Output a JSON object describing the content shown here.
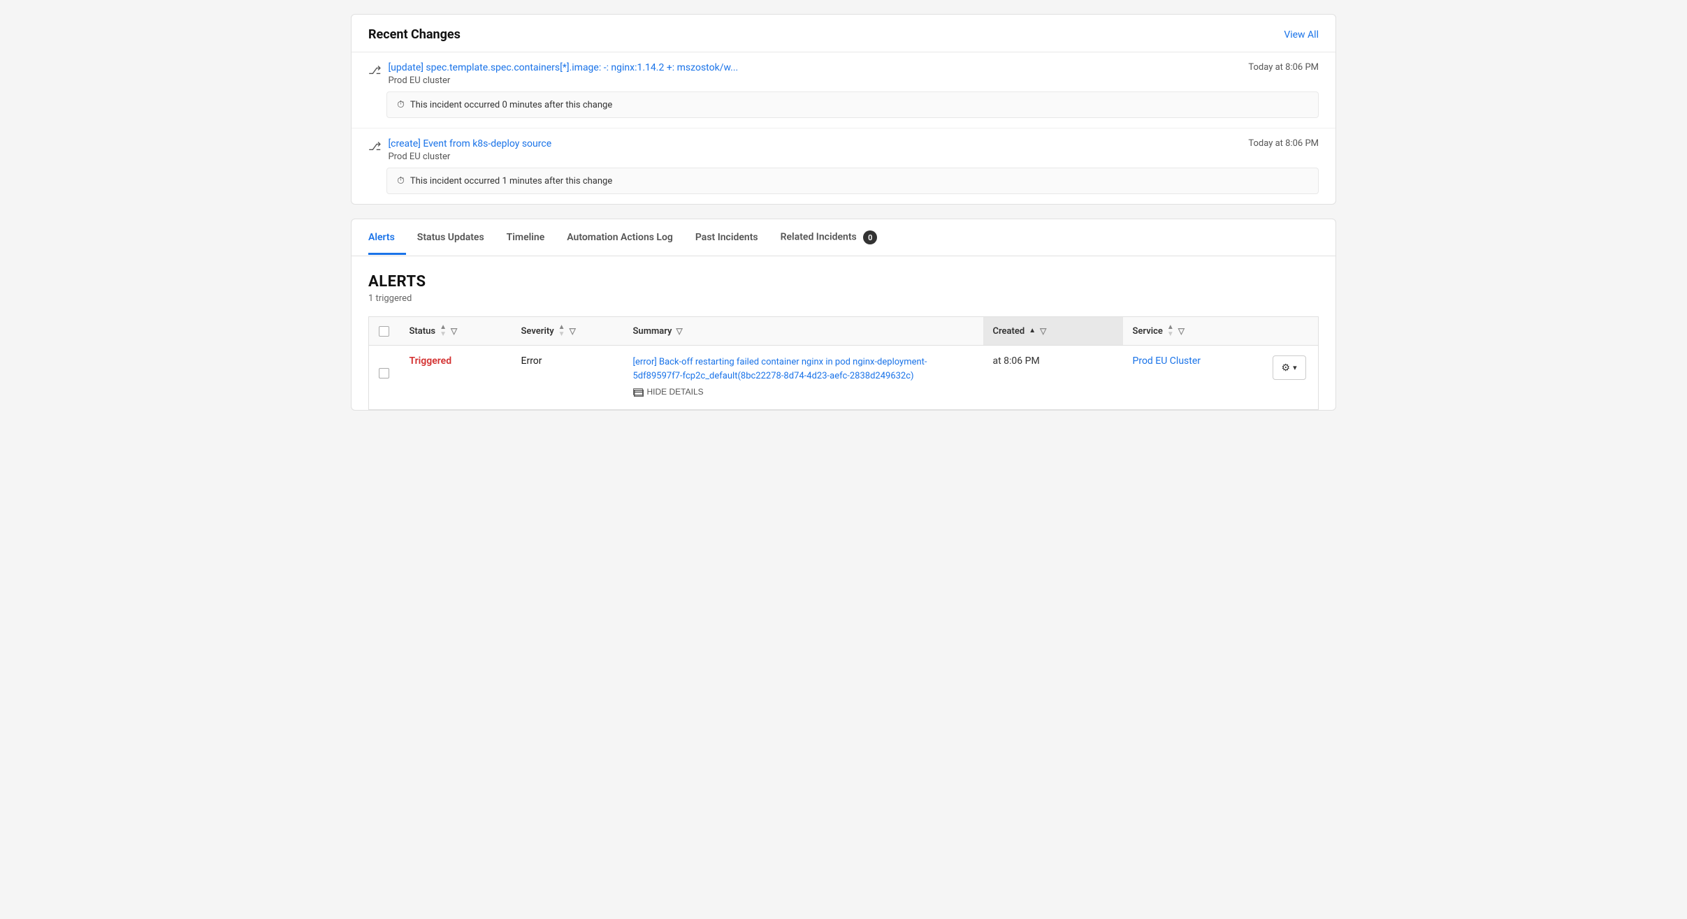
{
  "recent_changes": {
    "title": "Recent Changes",
    "view_all_label": "View All",
    "items": [
      {
        "id": "change-1",
        "link_text": "[update] spec.template.spec.containers[*].image: -: nginx:1.14.2 +: mszostok/w...",
        "cluster": "Prod EU cluster",
        "time": "Today at 8:06 PM",
        "notice": "This incident occurred 0 minutes after this change"
      },
      {
        "id": "change-2",
        "link_text": "[create] Event from k8s-deploy source",
        "cluster": "Prod EU cluster",
        "time": "Today at 8:06 PM",
        "notice": "This incident occurred 1 minutes after this change"
      }
    ]
  },
  "tabs": {
    "items": [
      {
        "label": "Alerts",
        "active": true,
        "badge": null
      },
      {
        "label": "Status Updates",
        "active": false,
        "badge": null
      },
      {
        "label": "Timeline",
        "active": false,
        "badge": null
      },
      {
        "label": "Automation Actions Log",
        "active": false,
        "badge": null
      },
      {
        "label": "Past Incidents",
        "active": false,
        "badge": null
      },
      {
        "label": "Related Incidents",
        "active": false,
        "badge": "0"
      }
    ]
  },
  "alerts": {
    "heading": "ALERTS",
    "subheading": "1 triggered",
    "table": {
      "columns": [
        {
          "key": "status",
          "label": "Status",
          "sorted": false
        },
        {
          "key": "severity",
          "label": "Severity",
          "sorted": false
        },
        {
          "key": "summary",
          "label": "Summary",
          "sorted": false
        },
        {
          "key": "created",
          "label": "Created",
          "sorted": true
        },
        {
          "key": "service",
          "label": "Service",
          "sorted": false
        }
      ],
      "rows": [
        {
          "status": "Triggered",
          "severity": "Error",
          "summary_link": "[error] Back-off restarting failed container nginx in pod nginx-deployment-5df89597f7-fcp2c_default(8bc22278-8d74-4d23-aefc-2838d249632c)",
          "hide_details_label": "HIDE DETAILS",
          "created": "at 8:06 PM",
          "service": "Prod EU Cluster"
        }
      ]
    }
  },
  "icons": {
    "git_merge": "⎇",
    "clock": "🕗",
    "sort_asc": "▲",
    "sort_desc": "▼",
    "filter": "⊽",
    "gear": "⚙",
    "chevron_down": "▾"
  }
}
